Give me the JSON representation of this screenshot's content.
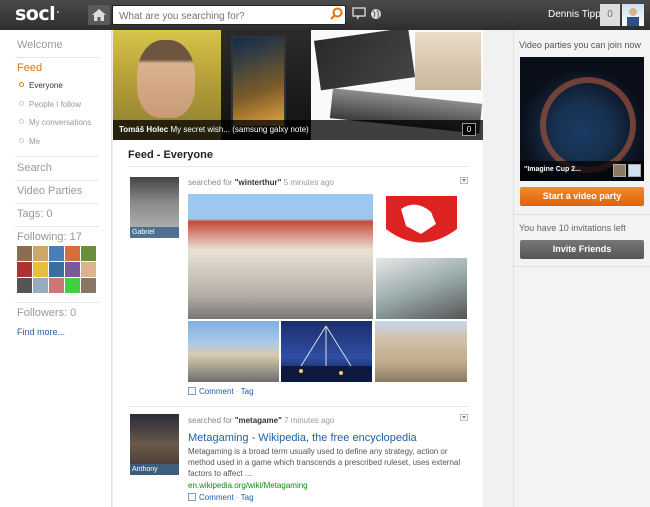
{
  "app": {
    "logo": "socl",
    "logo_mark": "."
  },
  "search": {
    "placeholder": "What are you searching for?"
  },
  "user": {
    "name": "Dennis Tippe",
    "notification_count": "0"
  },
  "left_nav": {
    "welcome": "Welcome",
    "feed": "Feed",
    "feed_sub": [
      "Everyone",
      "People I follow",
      "My conversations",
      "Me"
    ],
    "search": "Search",
    "video_parties": "Video Parties",
    "tags": "Tags: 0",
    "following": "Following: 17",
    "followers": "Followers: 0",
    "find_more": "Find more..."
  },
  "banner": {
    "author": "Tomáš Holec",
    "text": "My secret wish... (samsung galxy note)",
    "count": "0"
  },
  "feed": {
    "title": "Feed - Everyone",
    "posts": [
      {
        "author": "Gabriel",
        "prefix": "searched for",
        "query": "\"winterthur\"",
        "time": "5 minutes ago",
        "comment": "Comment",
        "tag": "Tag",
        "separator": "·"
      },
      {
        "author": "Anthony",
        "prefix": "searched for",
        "query": "\"metagame\"",
        "time": "7 minutes ago",
        "result_title": "Metagaming - Wikipedia, the free encyclopedia",
        "result_text": "Metagaming is a broad term usually used to define any strategy, action or method used in a game which transcends a prescribed ruleset, uses external factors to affect ...",
        "result_url": "en.wikipedia.org/wiki/Metagaming",
        "comment": "Comment",
        "tag": "Tag",
        "separator": "·"
      }
    ]
  },
  "right": {
    "video_parties_title": "Video parties you can join now",
    "party_caption": "\"Imagine Cup 2...",
    "start_button": "Start a video party",
    "invitations": "You have 10 invitations left",
    "invite_button": "Invite Friends"
  },
  "colors": {
    "accent": "#e8720c",
    "link": "#1f5fa9",
    "topbar": "#3a3a3a"
  }
}
